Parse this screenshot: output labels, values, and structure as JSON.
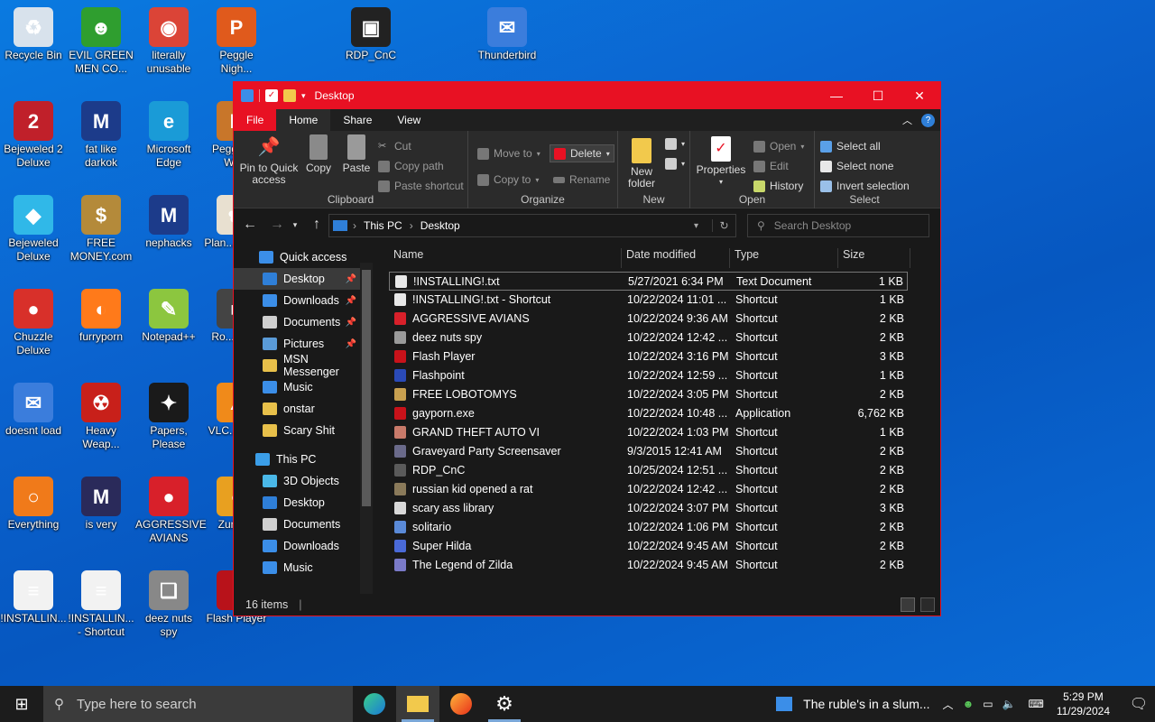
{
  "desktop": {
    "icons": [
      {
        "label": "Recycle Bin",
        "icon": "recycle-bin-icon",
        "color": "#d8e2ec",
        "glyph": "♻"
      },
      {
        "label": "EVIL GREEN MEN CO...",
        "icon": "green-men-icon",
        "color": "#2f9e2f",
        "glyph": "☻"
      },
      {
        "label": "literally unusable",
        "icon": "chrome-icon",
        "color": "#db4437",
        "glyph": "◉"
      },
      {
        "label": "Peggle Nigh...",
        "icon": "peggle-icon",
        "color": "#e05a1c",
        "glyph": "P"
      },
      {
        "label": "RDP_CnC",
        "icon": "rdp-icon",
        "color": "#222222",
        "glyph": "▣"
      },
      {
        "label": "Thunderbird",
        "icon": "thunderbird-icon",
        "color": "#3b7ddc",
        "glyph": "✉"
      },
      {
        "label": "Bejeweled 2 Deluxe",
        "icon": "bejeweled2-icon",
        "color": "#c0202a",
        "glyph": "2"
      },
      {
        "label": "fat like darkok",
        "icon": "mpi-icon",
        "color": "#1c3b8a",
        "glyph": "M"
      },
      {
        "label": "Microsoft Edge",
        "icon": "edge-icon",
        "color": "#1a9bd7",
        "glyph": "e"
      },
      {
        "label": "Peggl... of Wa...",
        "icon": "peggle-icon",
        "color": "#c8762a",
        "glyph": "P"
      },
      {
        "label": "Bejeweled Deluxe",
        "icon": "bejeweled-icon",
        "color": "#30b8e8",
        "glyph": "◆"
      },
      {
        "label": "FREE MONEY.com",
        "icon": "money-bag-icon",
        "color": "#b48a3a",
        "glyph": "$"
      },
      {
        "label": "nephacks",
        "icon": "mpi-icon",
        "color": "#1c3b8a",
        "glyph": "M"
      },
      {
        "label": "Plan... Zom...",
        "icon": "plants-icon",
        "color": "#e8e0d0",
        "glyph": "✿"
      },
      {
        "label": "Chuzzle Deluxe",
        "icon": "chuzzle-icon",
        "color": "#d8302a",
        "glyph": "●"
      },
      {
        "label": "furryporn",
        "icon": "firefox-icon",
        "color": "#ff7a1a",
        "glyph": "◐"
      },
      {
        "label": "Notepad++",
        "icon": "notepadpp-icon",
        "color": "#8cc63f",
        "glyph": "✎"
      },
      {
        "label": "Ro... Ma...",
        "icon": "game-icon",
        "color": "#444444",
        "glyph": "■"
      },
      {
        "label": "doesnt load",
        "icon": "thunderbird-icon",
        "color": "#3b7ddc",
        "glyph": "✉"
      },
      {
        "label": "Heavy Weap...",
        "icon": "radiation-icon",
        "color": "#c8201a",
        "glyph": "☢"
      },
      {
        "label": "Papers, Please",
        "icon": "papers-please-icon",
        "color": "#1a1a1a",
        "glyph": "✦"
      },
      {
        "label": "VLC... pla...",
        "icon": "vlc-icon",
        "color": "#f08a1a",
        "glyph": "▲"
      },
      {
        "label": "Everything",
        "icon": "everything-search-icon",
        "color": "#f07a1a",
        "glyph": "○"
      },
      {
        "label": "is very",
        "icon": "mpi-shield-icon",
        "color": "#2a2a5a",
        "glyph": "M"
      },
      {
        "label": "AGGRESSIVE AVIANS",
        "icon": "angry-bird-icon",
        "color": "#d8202a",
        "glyph": "●"
      },
      {
        "label": "Zuma...",
        "icon": "zuma-icon",
        "color": "#e8a020",
        "glyph": "●"
      },
      {
        "label": "!INSTALLIN...",
        "icon": "text-file-icon",
        "color": "#f2f2f2",
        "glyph": "≡"
      },
      {
        "label": "!INSTALLIN... - Shortcut",
        "icon": "text-file-icon",
        "color": "#f2f2f2",
        "glyph": "≡"
      },
      {
        "label": "deez nuts spy",
        "icon": "spy-icon",
        "color": "#888888",
        "glyph": "❑"
      },
      {
        "label": "Flash Player",
        "icon": "flash-player-icon",
        "color": "#b8121a",
        "glyph": "f"
      }
    ]
  },
  "window": {
    "title": "Desktop",
    "accent": "#e81123",
    "controls": {
      "minimize": "—",
      "maximize": "☐",
      "close": "✕"
    },
    "tabs": {
      "file": "File",
      "home": "Home",
      "share": "Share",
      "view": "View"
    },
    "ribbon": {
      "clipboard": {
        "pin": "Pin to Quick access",
        "copy": "Copy",
        "paste": "Paste",
        "cut": "Cut",
        "copy_path": "Copy path",
        "paste_shortcut": "Paste shortcut",
        "label": "Clipboard"
      },
      "organize": {
        "move_to": "Move to",
        "copy_to": "Copy to",
        "delete": "Delete",
        "rename": "Rename",
        "label": "Organize"
      },
      "new": {
        "new_folder": "New folder",
        "label": "New"
      },
      "open": {
        "properties": "Properties",
        "open": "Open",
        "edit": "Edit",
        "history": "History",
        "label": "Open"
      },
      "select": {
        "select_all": "Select all",
        "select_none": "Select none",
        "invert": "Invert selection",
        "label": "Select"
      }
    },
    "address": {
      "this_pc": "This PC",
      "desktop": "Desktop",
      "sep": "›"
    },
    "search_placeholder": "Search Desktop",
    "nav": [
      {
        "label": "Quick access",
        "icon": "star-icon",
        "color": "#3b8ee8",
        "pinned": false
      },
      {
        "label": "Desktop",
        "icon": "desktop-folder-icon",
        "color": "#2f7fd8",
        "pinned": true
      },
      {
        "label": "Downloads",
        "icon": "downloads-icon",
        "color": "#3b8ee8",
        "pinned": true
      },
      {
        "label": "Documents",
        "icon": "documents-icon",
        "color": "#cfcfcf",
        "pinned": true
      },
      {
        "label": "Pictures",
        "icon": "pictures-icon",
        "color": "#5a9bd8",
        "pinned": true
      },
      {
        "label": "MSN Messenger",
        "icon": "folder-icon",
        "color": "#e8c04a",
        "pinned": false
      },
      {
        "label": "Music",
        "icon": "music-icon",
        "color": "#3b8ee8",
        "pinned": false
      },
      {
        "label": "onstar",
        "icon": "folder-icon",
        "color": "#e8c04a",
        "pinned": false
      },
      {
        "label": "Scary Shit",
        "icon": "folder-icon",
        "color": "#e8c04a",
        "pinned": false
      },
      {
        "label": "This PC",
        "icon": "computer-icon",
        "color": "#3b9ee8",
        "pinned": false
      },
      {
        "label": "3D Objects",
        "icon": "3d-objects-icon",
        "color": "#4ab8e8",
        "pinned": false
      },
      {
        "label": "Desktop",
        "icon": "desktop-folder-icon",
        "color": "#2f7fd8",
        "pinned": false
      },
      {
        "label": "Documents",
        "icon": "documents-icon",
        "color": "#cfcfcf",
        "pinned": false
      },
      {
        "label": "Downloads",
        "icon": "downloads-icon",
        "color": "#3b8ee8",
        "pinned": false
      },
      {
        "label": "Music",
        "icon": "music-icon",
        "color": "#3b8ee8",
        "pinned": false
      }
    ],
    "columns": {
      "name": "Name",
      "date": "Date modified",
      "type": "Type",
      "size": "Size"
    },
    "files": [
      {
        "name": "!INSTALLING!.txt",
        "date": "5/27/2021 6:34 PM",
        "type": "Text Document",
        "size": "1 KB",
        "icon": "text-file-icon",
        "color": "#e8e8e8"
      },
      {
        "name": "!INSTALLING!.txt - Shortcut",
        "date": "10/22/2024 11:01 ...",
        "type": "Shortcut",
        "size": "1 KB",
        "icon": "text-file-icon",
        "color": "#e8e8e8"
      },
      {
        "name": "AGGRESSIVE AVIANS",
        "date": "10/22/2024 9:36 AM",
        "type": "Shortcut",
        "size": "2 KB",
        "icon": "angry-bird-icon",
        "color": "#d8202a"
      },
      {
        "name": "deez nuts spy",
        "date": "10/22/2024 12:42 ...",
        "type": "Shortcut",
        "size": "2 KB",
        "icon": "spy-icon",
        "color": "#9a9a9a"
      },
      {
        "name": "Flash Player",
        "date": "10/22/2024 3:16 PM",
        "type": "Shortcut",
        "size": "3 KB",
        "icon": "flash-player-icon",
        "color": "#c8121a"
      },
      {
        "name": "Flashpoint",
        "date": "10/22/2024 12:59 ...",
        "type": "Shortcut",
        "size": "1 KB",
        "icon": "flashpoint-icon",
        "color": "#2a4ab8"
      },
      {
        "name": "FREE LOBOTOMYS",
        "date": "10/22/2024 3:05 PM",
        "type": "Shortcut",
        "size": "2 KB",
        "icon": "money-bag-icon",
        "color": "#c8a050"
      },
      {
        "name": "gayporn.exe",
        "date": "10/22/2024 10:48 ...",
        "type": "Application",
        "size": "6,762 KB",
        "icon": "flash-player-icon",
        "color": "#c8121a"
      },
      {
        "name": "GRAND THEFT AUTO VI",
        "date": "10/22/2024 1:03 PM",
        "type": "Shortcut",
        "size": "1 KB",
        "icon": "gta-icon",
        "color": "#c87a6a"
      },
      {
        "name": "Graveyard Party Screensaver",
        "date": "9/3/2015 12:41 AM",
        "type": "Shortcut",
        "size": "2 KB",
        "icon": "screensaver-icon",
        "color": "#6a6a8a"
      },
      {
        "name": "RDP_CnC",
        "date": "10/25/2024 12:51 ...",
        "type": "Shortcut",
        "size": "2 KB",
        "icon": "rdp-icon",
        "color": "#5a5a5a"
      },
      {
        "name": "russian kid opened a rat",
        "date": "10/22/2024 12:42 ...",
        "type": "Shortcut",
        "size": "2 KB",
        "icon": "image-icon",
        "color": "#8a7a5a"
      },
      {
        "name": "scary ass library",
        "date": "10/22/2024 3:07 PM",
        "type": "Shortcut",
        "size": "3 KB",
        "icon": "library-icon",
        "color": "#d8d8d8"
      },
      {
        "name": "solitario",
        "date": "10/22/2024 1:06 PM",
        "type": "Shortcut",
        "size": "2 KB",
        "icon": "cards-icon",
        "color": "#5a8ad8"
      },
      {
        "name": "Super Hilda",
        "date": "10/22/2024 9:45 AM",
        "type": "Shortcut",
        "size": "2 KB",
        "icon": "game-icon",
        "color": "#4a6ad8"
      },
      {
        "name": "The Legend of Zilda",
        "date": "10/22/2024 9:45 AM",
        "type": "Shortcut",
        "size": "2 KB",
        "icon": "game-icon",
        "color": "#7a7ac8"
      }
    ],
    "status": "16 items"
  },
  "taskbar": {
    "search_placeholder": "Type here to search",
    "news": "The ruble's in a slum...",
    "time": "5:29 PM",
    "date": "11/29/2024"
  }
}
